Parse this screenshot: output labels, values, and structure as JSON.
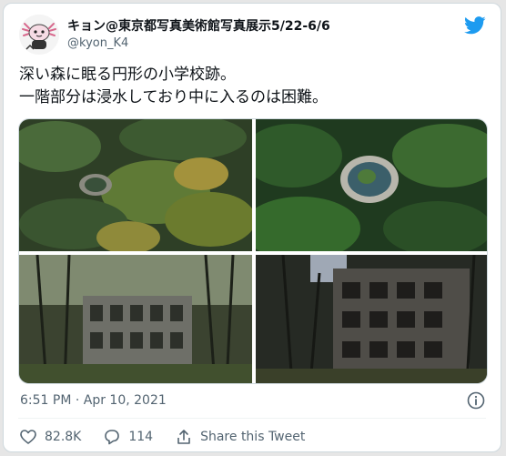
{
  "tweet": {
    "display_name": "キョン@東京都写真美術館写真展示5/22-6/6",
    "handle": "@kyon_K4",
    "text_lines": [
      "深い森に眠る円形の小学校跡。",
      "一階部分は浸水しており中に入るのは困難。"
    ],
    "timestamp": "6:51 PM · Apr 10, 2021",
    "likes": "82.8K",
    "replies": "114",
    "share_label": "Share this Tweet"
  },
  "icons": {
    "brand": "twitter-bird-icon",
    "info": "info-icon",
    "like": "heart-icon",
    "reply": "reply-icon",
    "share": "share-icon"
  },
  "colors": {
    "brand": "#1d9bf0",
    "secondary_text": "#536471",
    "border": "#cfd9de"
  }
}
